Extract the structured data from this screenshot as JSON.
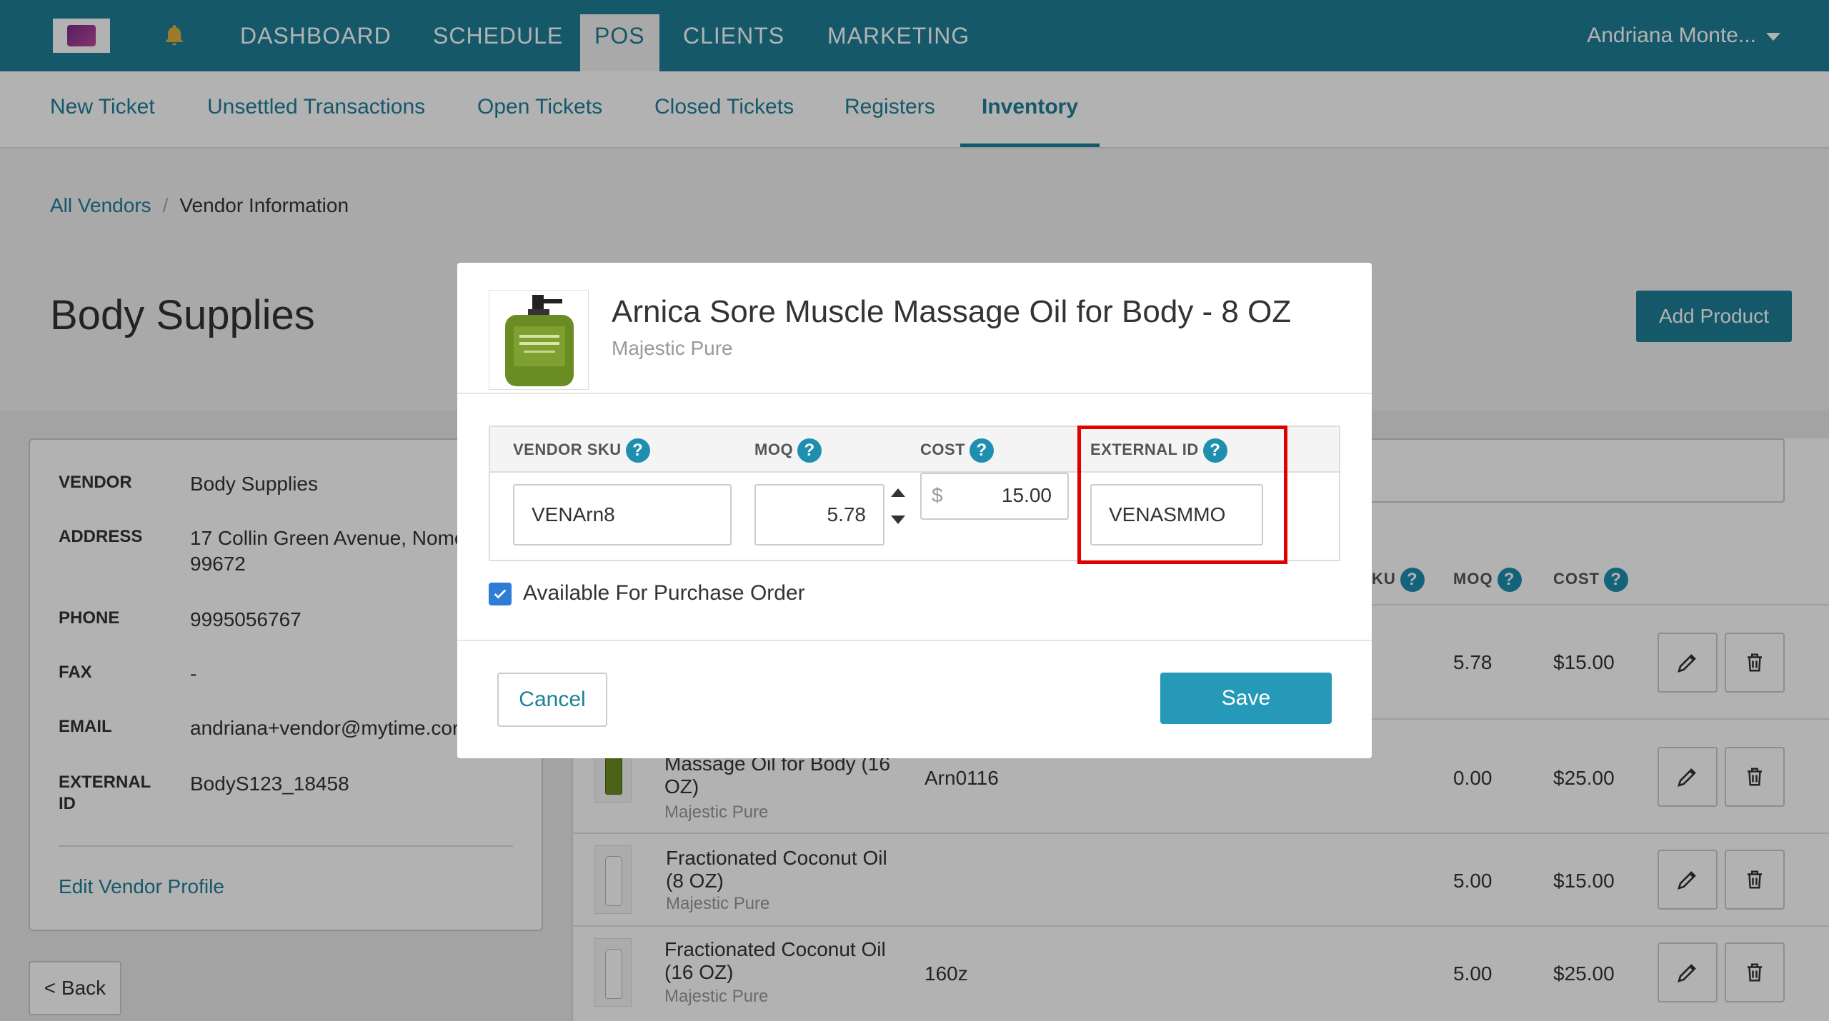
{
  "topnav": {
    "items": [
      "DASHBOARD",
      "SCHEDULE",
      "POS",
      "CLIENTS",
      "MARKETING"
    ],
    "active": "POS",
    "user": "Andriana Monte..."
  },
  "subnav": {
    "items": [
      "New Ticket",
      "Unsettled Transactions",
      "Open Tickets",
      "Closed Tickets",
      "Registers",
      "Inventory"
    ],
    "active": "Inventory"
  },
  "breadcrumb": {
    "parent": "All Vendors",
    "sep": "/",
    "current": "Vendor Information"
  },
  "page": {
    "title": "Body Supplies",
    "add_product": "Add Product",
    "back": "< Back"
  },
  "vendor": {
    "rows": [
      {
        "label": "VENDOR",
        "value": "Body Supplies"
      },
      {
        "label": "ADDRESS",
        "value": "17 Collin Green Avenue, Nome",
        "value2": "99672"
      },
      {
        "label": "PHONE",
        "value": "9995056767"
      },
      {
        "label": "FAX",
        "value": "-"
      },
      {
        "label": "EMAIL",
        "value": "andriana+vendor@mytime.cor"
      },
      {
        "label": "EXTERNAL",
        "label2": "ID",
        "value": "BodyS123_18458"
      }
    ],
    "edit_link": "Edit Vendor Profile"
  },
  "products_table": {
    "headers": {
      "sku_partial": "KU",
      "moq": "MOQ",
      "cost": "COST",
      "help": "?"
    },
    "rows": [
      {
        "name": "",
        "brand": "",
        "sku": "",
        "moq": "5.78",
        "cost": "$15.00"
      },
      {
        "name": "Massage Oil for Body (16 OZ)",
        "brand": "Majestic Pure",
        "sku": "Arn0116",
        "moq": "0.00",
        "cost": "$25.00"
      },
      {
        "name": "Fractionated Coconut Oil (8 OZ)",
        "brand": "Majestic Pure",
        "sku": "",
        "moq": "5.00",
        "cost": "$15.00"
      },
      {
        "name": "Fractionated Coconut Oil (16 OZ)",
        "brand": "Majestic Pure",
        "sku": "160z",
        "moq": "5.00",
        "cost": "$25.00"
      }
    ]
  },
  "modal": {
    "title": "Arnica Sore Muscle Massage Oil for Body - 8 OZ",
    "brand": "Majestic Pure",
    "columns": {
      "vendor_sku": "VENDOR SKU",
      "moq": "MOQ",
      "cost": "COST",
      "external_id": "EXTERNAL ID"
    },
    "values": {
      "vendor_sku": "VENArn8",
      "moq": "5.78",
      "currency": "$",
      "cost": "15.00",
      "external_id": "VENASMMO"
    },
    "available_label": "Available For Purchase Order",
    "available_checked": true,
    "cancel": "Cancel",
    "save": "Save"
  },
  "colors": {
    "brand": "#1f7f99",
    "save": "#2599b7",
    "highlight": "#e00000",
    "checkbox": "#2e7cd6"
  }
}
